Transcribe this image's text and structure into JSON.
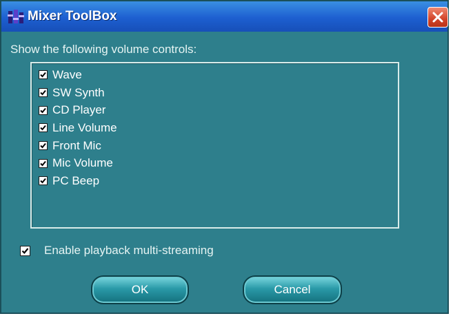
{
  "window": {
    "title": "Mixer ToolBox",
    "app_icon": "mixer-app-icon",
    "close_icon": "close-x-icon"
  },
  "colors": {
    "window_bg": "#2e7f8c",
    "titlebar": "#1d5fd0",
    "close_button": "#d2442a",
    "text": "#ffffff"
  },
  "volume_controls": {
    "label": "Show the following volume controls:",
    "items": [
      {
        "label": "Wave",
        "checked": true
      },
      {
        "label": "SW Synth",
        "checked": true
      },
      {
        "label": "CD Player",
        "checked": true
      },
      {
        "label": "Line Volume",
        "checked": true
      },
      {
        "label": "Front Mic",
        "checked": true
      },
      {
        "label": "Mic Volume",
        "checked": true
      },
      {
        "label": "PC Beep",
        "checked": true
      }
    ]
  },
  "multistreaming": {
    "label": "Enable playback multi-streaming",
    "checked": true
  },
  "buttons": {
    "ok_label": "OK",
    "cancel_label": "Cancel"
  }
}
